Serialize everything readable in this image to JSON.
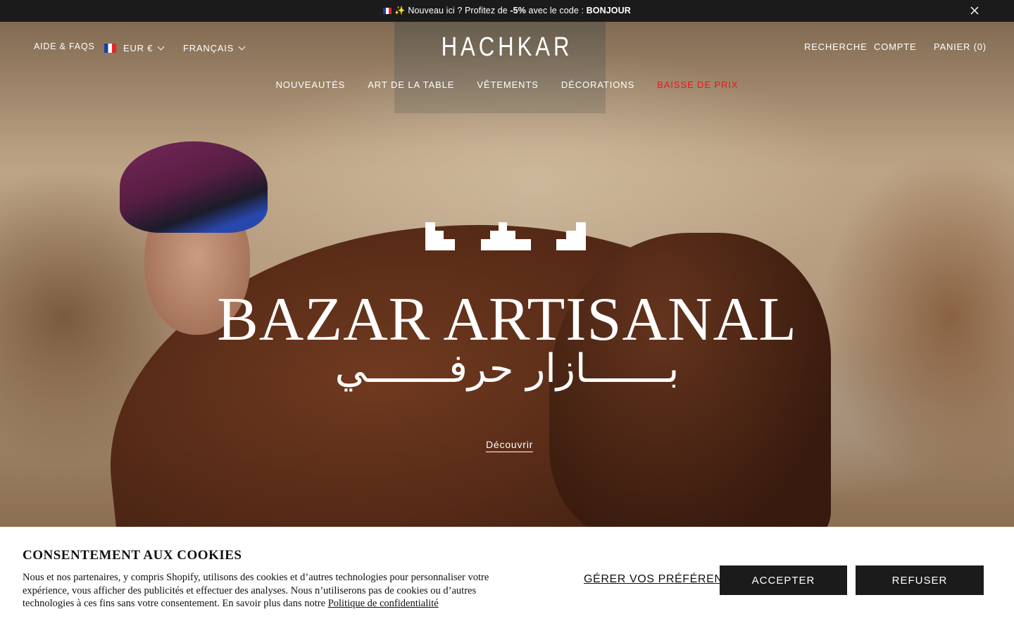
{
  "announcement": {
    "text_before": "✨ Nouveau ici ? Profitez de ",
    "discount": "-5%",
    "text_middle": " avec le code : ",
    "code": "BONJOUR"
  },
  "header": {
    "help": "AIDE & FAQS",
    "currency": "EUR €",
    "language": "FRANÇAIS",
    "logo": "HACHKAR",
    "search": "RECHERCHE",
    "account": "COMPTE",
    "cart": "PANIER (0)"
  },
  "nav": {
    "items": [
      "NOUVEAUTÉS",
      "ART DE LA TABLE",
      "VÊTEMENTS",
      "DÉCORATIONS",
      "BAISSE DE PRIX"
    ],
    "sale_color": "#e11b1b"
  },
  "hero": {
    "title": "BAZAR ARTISANAL",
    "arabic": "بـــــــازار حرفـــــــي",
    "cta": "Découvrir"
  },
  "cookie": {
    "title": "CONSENTEMENT AUX COOKIES",
    "body": "Nous et nos partenaires, y compris Shopify, utilisons des cookies et d’autres technologies pour personnaliser votre expérience, vous afficher des publicités et effectuer des analyses. Nous n’utiliserons pas de cookies ou d’autres technologies à ces fins sans votre consentement. En savoir plus dans notre ",
    "policy_link": "Politique de confidentialité",
    "preferences": "GÉRER VOS PRÉFÉRENCES",
    "accept": "ACCEPTER",
    "refuse": "REFUSER"
  }
}
